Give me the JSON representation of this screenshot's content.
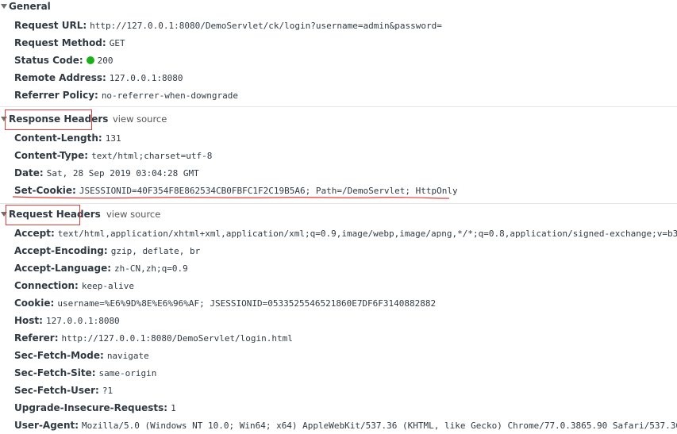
{
  "general": {
    "title": "General",
    "rows": [
      {
        "key": "Request URL:",
        "value": "http://127.0.0.1:8080/DemoServlet/ck/login?username=admin&password="
      },
      {
        "key": "Request Method:",
        "value": "GET"
      },
      {
        "key": "Status Code:",
        "value": "200"
      },
      {
        "key": "Remote Address:",
        "value": "127.0.0.1:8080"
      },
      {
        "key": "Referrer Policy:",
        "value": "no-referrer-when-downgrade"
      }
    ]
  },
  "response_headers": {
    "title": "Response Headers",
    "view_source": "view source",
    "rows": [
      {
        "key": "Content-Length:",
        "value": "131"
      },
      {
        "key": "Content-Type:",
        "value": "text/html;charset=utf-8"
      },
      {
        "key": "Date:",
        "value": "Sat, 28 Sep 2019 03:04:28 GMT"
      },
      {
        "key": "Set-Cookie:",
        "value": "JSESSIONID=40F354F8E862534CB0FBFC1F2C19B5A6; Path=/DemoServlet; HttpOnly"
      }
    ]
  },
  "request_headers": {
    "title": "Request Headers",
    "view_source": "view source",
    "rows": [
      {
        "key": "Accept:",
        "value": "text/html,application/xhtml+xml,application/xml;q=0.9,image/webp,image/apng,*/*;q=0.8,application/signed-exchange;v=b3"
      },
      {
        "key": "Accept-Encoding:",
        "value": "gzip, deflate, br"
      },
      {
        "key": "Accept-Language:",
        "value": "zh-CN,zh;q=0.9"
      },
      {
        "key": "Connection:",
        "value": "keep-alive"
      },
      {
        "key": "Cookie:",
        "value": "username=%E6%9D%8E%E6%96%AF; JSESSIONID=0533525546521860E7DF6F3140882882"
      },
      {
        "key": "Host:",
        "value": "127.0.0.1:8080"
      },
      {
        "key": "Referer:",
        "value": "http://127.0.0.1:8080/DemoServlet/login.html"
      },
      {
        "key": "Sec-Fetch-Mode:",
        "value": "navigate"
      },
      {
        "key": "Sec-Fetch-Site:",
        "value": "same-origin"
      },
      {
        "key": "Sec-Fetch-User:",
        "value": "?1"
      },
      {
        "key": "Upgrade-Insecure-Requests:",
        "value": "1"
      },
      {
        "key": "User-Agent:",
        "value": "Mozilla/5.0 (Windows NT 10.0; Win64; x64) AppleWebKit/537.36 (KHTML, like Gecko) Chrome/77.0.3865.90 Safari/537.36"
      }
    ]
  },
  "colors": {
    "annotation": "#e23b3b",
    "status_ok": "#18b118"
  }
}
